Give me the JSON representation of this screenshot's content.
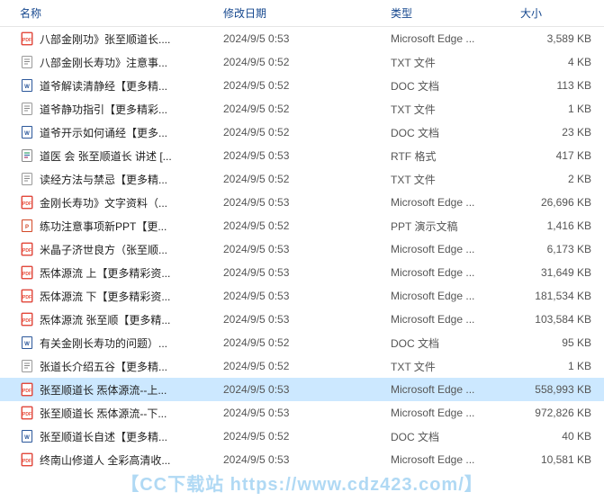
{
  "columns": {
    "name": "名称",
    "date": "修改日期",
    "type": "类型",
    "size": "大小"
  },
  "icons": {
    "pdf": "pdf",
    "txt": "txt",
    "doc": "doc",
    "rtf": "rtf",
    "ppt": "ppt"
  },
  "selectedIndex": 15,
  "files": [
    {
      "icon": "pdf",
      "name": "八部金刚功》张至顺道长....",
      "date": "2024/9/5 0:53",
      "type": "Microsoft Edge ...",
      "size": "3,589 KB"
    },
    {
      "icon": "txt",
      "name": "八部金刚长寿功》注意事...",
      "date": "2024/9/5 0:52",
      "type": "TXT 文件",
      "size": "4 KB"
    },
    {
      "icon": "doc",
      "name": "道爷解读清静经【更多精...",
      "date": "2024/9/5 0:52",
      "type": "DOC 文档",
      "size": "113 KB"
    },
    {
      "icon": "txt",
      "name": "道爷静功指引【更多精彩...",
      "date": "2024/9/5 0:52",
      "type": "TXT 文件",
      "size": "1 KB"
    },
    {
      "icon": "doc",
      "name": "道爷开示如何诵经【更多...",
      "date": "2024/9/5 0:52",
      "type": "DOC 文档",
      "size": "23 KB"
    },
    {
      "icon": "rtf",
      "name": "道医 会 张至顺道长 讲述 [...",
      "date": "2024/9/5 0:53",
      "type": "RTF 格式",
      "size": "417 KB"
    },
    {
      "icon": "txt",
      "name": "读经方法与禁忌【更多精...",
      "date": "2024/9/5 0:52",
      "type": "TXT 文件",
      "size": "2 KB"
    },
    {
      "icon": "pdf",
      "name": "金刚长寿功》文字资料（...",
      "date": "2024/9/5 0:53",
      "type": "Microsoft Edge ...",
      "size": "26,696 KB"
    },
    {
      "icon": "ppt",
      "name": "练功注意事项新PPT【更...",
      "date": "2024/9/5 0:52",
      "type": "PPT 演示文稿",
      "size": "1,416 KB"
    },
    {
      "icon": "pdf",
      "name": "米晶子济世良方（张至顺...",
      "date": "2024/9/5 0:53",
      "type": "Microsoft Edge ...",
      "size": "6,173 KB"
    },
    {
      "icon": "pdf",
      "name": "炁体源流 上【更多精彩资...",
      "date": "2024/9/5 0:53",
      "type": "Microsoft Edge ...",
      "size": "31,649 KB"
    },
    {
      "icon": "pdf",
      "name": "炁体源流 下【更多精彩资...",
      "date": "2024/9/5 0:53",
      "type": "Microsoft Edge ...",
      "size": "181,534 KB"
    },
    {
      "icon": "pdf",
      "name": "炁体源流 张至顺【更多精...",
      "date": "2024/9/5 0:53",
      "type": "Microsoft Edge ...",
      "size": "103,584 KB"
    },
    {
      "icon": "doc",
      "name": "有关金刚长寿功的问题）...",
      "date": "2024/9/5 0:52",
      "type": "DOC 文档",
      "size": "95 KB"
    },
    {
      "icon": "txt",
      "name": "张道长介绍五谷【更多精...",
      "date": "2024/9/5 0:52",
      "type": "TXT 文件",
      "size": "1 KB"
    },
    {
      "icon": "pdf",
      "name": "张至顺道长 炁体源流--上...",
      "date": "2024/9/5 0:53",
      "type": "Microsoft Edge ...",
      "size": "558,993 KB"
    },
    {
      "icon": "pdf",
      "name": "张至顺道长 炁体源流--下...",
      "date": "2024/9/5 0:53",
      "type": "Microsoft Edge ...",
      "size": "972,826 KB"
    },
    {
      "icon": "doc",
      "name": "张至顺道长自述【更多精...",
      "date": "2024/9/5 0:52",
      "type": "DOC 文档",
      "size": "40 KB"
    },
    {
      "icon": "pdf",
      "name": "终南山修道人 全彩高清收...",
      "date": "2024/9/5 0:53",
      "type": "Microsoft Edge ...",
      "size": "10,581 KB"
    }
  ],
  "watermark": "【CC下载站 https://www.cdz423.com/】"
}
